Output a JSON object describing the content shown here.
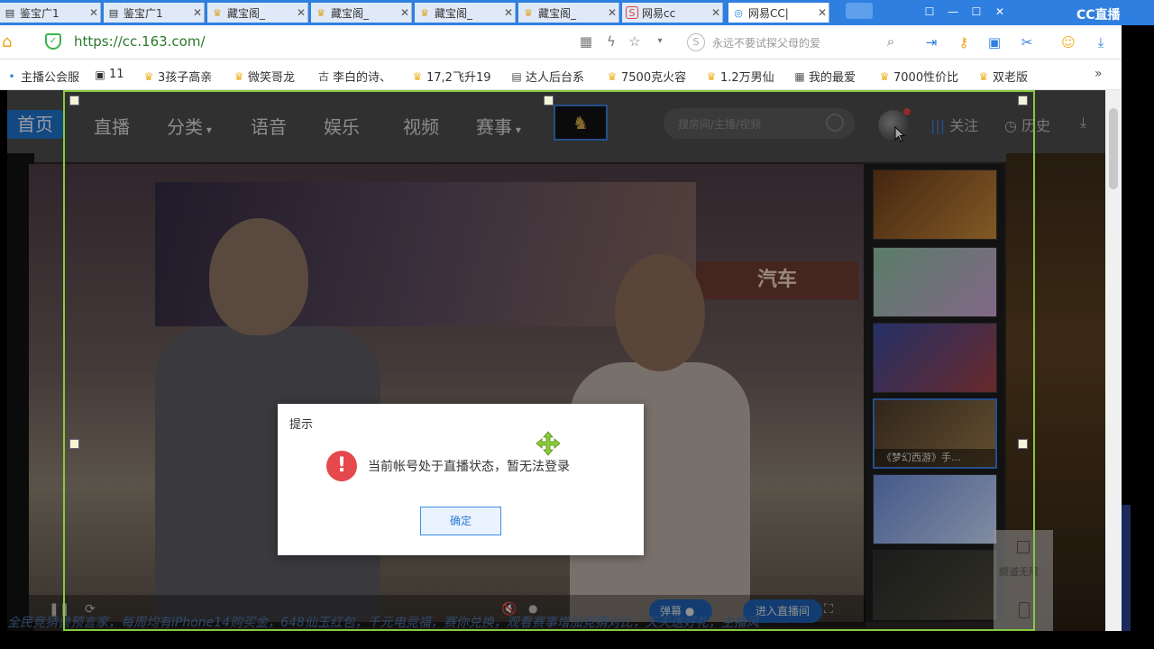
{
  "browser": {
    "tabs": [
      {
        "label": "鉴宝广1",
        "icon": "page-icon",
        "active": false
      },
      {
        "label": "鉴宝广1",
        "icon": "page-icon",
        "active": false
      },
      {
        "label": "藏宝阁_",
        "icon": "crown-icon",
        "active": false
      },
      {
        "label": "藏宝阁_",
        "icon": "crown-icon",
        "active": false
      },
      {
        "label": "藏宝阁_",
        "icon": "crown-icon",
        "active": false
      },
      {
        "label": "藏宝阁_",
        "icon": "crown-icon",
        "active": false
      },
      {
        "label": "网易cc",
        "icon": "s-icon",
        "active": false
      },
      {
        "label": "网易CC|",
        "icon": "cc-icon",
        "active": true
      }
    ],
    "brand": "CC直播",
    "url": "https://cc.163.com/",
    "search_placeholder": "永远不要试探父母的爱",
    "bookmarks": [
      "主播公会服",
      "11",
      "3孩子高亲",
      "微笑哥龙",
      "李白的诗、",
      "17,2飞升19",
      "达人后台系",
      "7500克火容",
      "1.2万男仙",
      "我的最爱",
      "7000性价比",
      "双老版"
    ]
  },
  "site": {
    "nav": {
      "home": "首页",
      "items": [
        "直播",
        "分类",
        "语音",
        "娱乐",
        "视频",
        "赛事"
      ],
      "search_placeholder": "搜房间/主播/视频",
      "follow": "关注",
      "history": "历史"
    },
    "video": {
      "sign_text": "汽车",
      "danmu_label": "弹幕",
      "enter_label": "进入直播间",
      "ticker": "全民竞猜兽预言家，每周均有iPhone14购买金，648仙玉红包，千元电竞福，赛你兑换，观看赛事增加竞猜对比，天天送好礼，主播风"
    },
    "rail": [
      {
        "caption": ""
      },
      {
        "caption": ""
      },
      {
        "caption": ""
      },
      {
        "caption": "《梦幻西游》手..."
      },
      {
        "caption": ""
      },
      {
        "caption": ""
      }
    ],
    "side_tool_label": "频道无限"
  },
  "modal": {
    "title": "提示",
    "message": "当前帐号处于直播状态，暂无法登录",
    "confirm": "确定"
  },
  "colors": {
    "tab_strip": "#2e7fe0",
    "selection": "#86c93e",
    "alert": "#e5484d",
    "primary": "#3a8ee6"
  }
}
